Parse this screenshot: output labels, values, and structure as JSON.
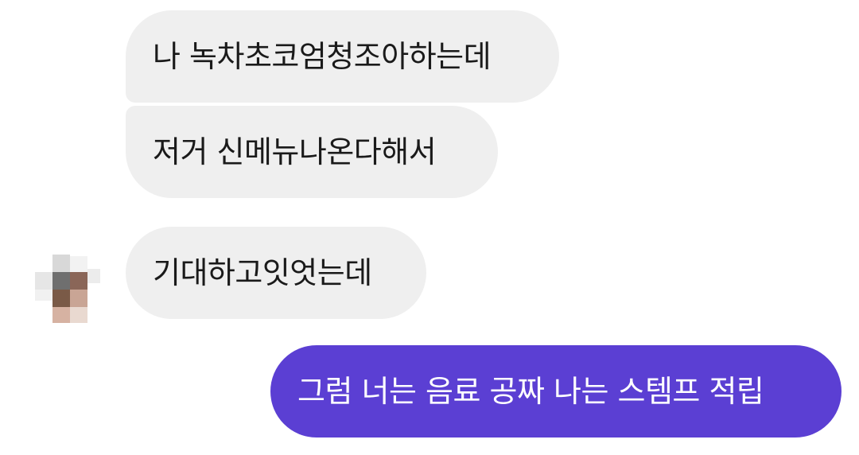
{
  "chat": {
    "messages": [
      {
        "sender": "other",
        "text": "나 녹차초코엄청조아하는데"
      },
      {
        "sender": "other",
        "text": "저거 신메뉴나온다해서"
      },
      {
        "sender": "other",
        "text": "기대하고잇엇는데"
      },
      {
        "sender": "me",
        "text": "그럼 너는 음료 공짜 나는 스템프 적립"
      }
    ],
    "colors": {
      "incoming_bubble": "#efefef",
      "outgoing_bubble": "#5b3fd3",
      "incoming_text": "#1a1a1a",
      "outgoing_text": "#ffffff"
    }
  }
}
